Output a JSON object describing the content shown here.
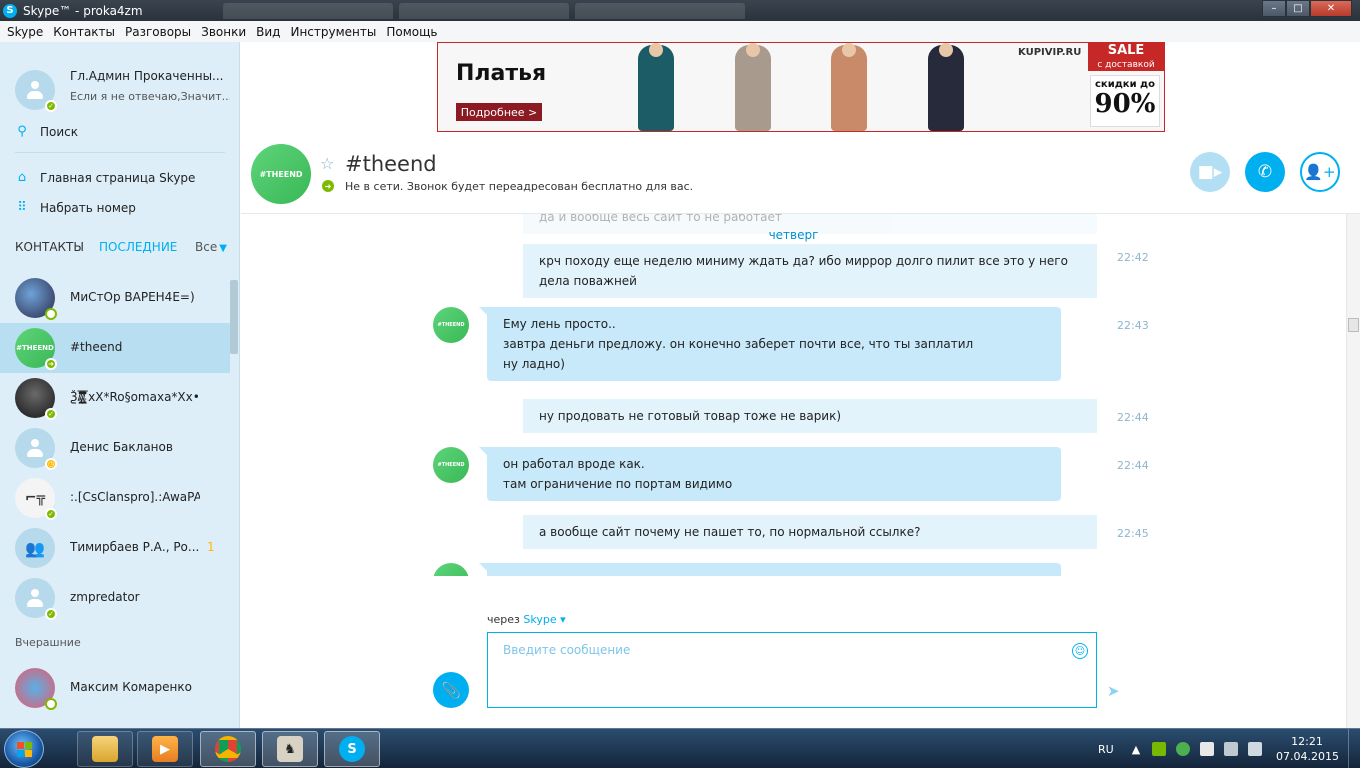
{
  "window": {
    "title": "Skype™ - proka4zm",
    "minimize": "–",
    "maximize": "□",
    "close": "✕"
  },
  "menu": [
    "Skype",
    "Контакты",
    "Разговоры",
    "Звонки",
    "Вид",
    "Инструменты",
    "Помощь"
  ],
  "profile": {
    "name": "Гл.Админ Прокаченны...",
    "mood": "Если я не отвечаю,Значит..."
  },
  "sidebar": {
    "search_label": "Поиск",
    "home_label": "Главная страница Skype",
    "dial_label": "Набрать номер",
    "tab_contacts": "КОНТАКТЫ",
    "tab_recent": "ПОСЛЕДНИЕ",
    "filter": "Все",
    "section_yesterday": "Вчерашние",
    "contacts": [
      {
        "name": "МиСтОр ВАРЕН4Е=)",
        "avatar": "photo",
        "status": "offline"
      },
      {
        "name": "#theend",
        "avatar": "theend",
        "status": "forward",
        "avatar_text": "#THEEND"
      },
      {
        "name": "Ѯ/̸̵̡̜̪͕̘̤̐̈͆͑̊̂̅̅̅ͅ/̸̵̡̜̪͕̘̤̐̈͆͑̊̂̅̅̅ͅ xX*Ro§omaxa*Xx•",
        "avatar": "dark",
        "status": "online"
      },
      {
        "name": "Денис Бакланов",
        "avatar": "default",
        "status": "away"
      },
      {
        "name": ":.[CsClanspro].:AwaPA",
        "avatar": "gun",
        "status": "online"
      },
      {
        "name": "Тимирбаев Р.А., Ро...",
        "avatar": "group",
        "status": "none",
        "badge": "1"
      },
      {
        "name": "zmpredator",
        "avatar": "default",
        "status": "online"
      }
    ],
    "yesterday_contacts": [
      {
        "name": "Максим Комаренко",
        "avatar": "pony",
        "status": "offline"
      }
    ]
  },
  "ad": {
    "title": "Платья",
    "button": "Подробнее >",
    "brand": "KUPIVIP.RU",
    "sale": "SALE",
    "sale_sub": "с доставкой",
    "discount_text": "скидки до",
    "discount_value": "90%",
    "dress_colors": [
      "#1c5c66",
      "#a89a8c",
      "#c98a6a",
      "#262a3a"
    ]
  },
  "conversation": {
    "name": "#theend",
    "avatar_text": "#THEEND",
    "status": "Не в сети. Звонок будет переадресован бесплатно для вас.",
    "day_separator": "четверг",
    "faded_text": "да и вообще весь сайт то не работает",
    "messages": [
      {
        "dir": "out",
        "lines": [
          "крч походу еще неделю миниму ждать да? ибо миррор долго пилит все это у него",
          "дела поважней"
        ],
        "time": "22:42"
      },
      {
        "dir": "in",
        "lines": [
          "Ему лень просто..",
          "завтра деньги предложу. он конечно заберет почти все, что ты заплатил",
          "ну ладно)"
        ],
        "time": "22:43"
      },
      {
        "dir": "out",
        "lines": [
          "ну продовать не готовый товар тоже не варик)"
        ],
        "time": "22:44"
      },
      {
        "dir": "in",
        "lines": [
          "он работал вроде как.",
          "там ограничение по портам видимо"
        ],
        "time": "22:44"
      },
      {
        "dir": "out",
        "lines": [
          "а вообще сайт почему не пашет то, по нормальной ссылке?"
        ],
        "time": "22:45"
      }
    ]
  },
  "composer": {
    "via_prefix": "через",
    "via_link": "Skype",
    "placeholder": "Введите сообщение"
  },
  "taskbar": {
    "language": "RU",
    "time": "12:21",
    "date": "07.04.2015"
  },
  "colors": {
    "accent": "#00aff0",
    "sidebar_bg": "#ddeef8",
    "bubble_in": "#c7e9fa",
    "bubble_out": "#e3f3fc",
    "online": "#7fba00",
    "away": "#ffb900"
  }
}
